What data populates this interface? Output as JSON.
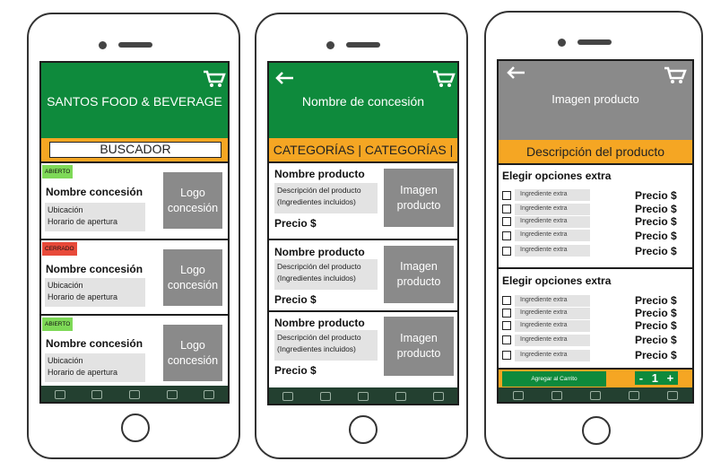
{
  "phone1": {
    "header_title": "SANTOS FOOD & BEVERAGE",
    "search_label": "BUSCADOR",
    "cards": [
      {
        "status": "ABIERTO",
        "name": "Nombre concesión",
        "location": "Ubicación",
        "hours": "Horario de apertura",
        "logo_line1": "Logo",
        "logo_line2": "concesión"
      },
      {
        "status": "CERRADO",
        "name": "Nombre concesión",
        "location": "Ubicación",
        "hours": "Horario de apertura",
        "logo_line1": "Logo",
        "logo_line2": "concesión"
      },
      {
        "status": "ABIERTO",
        "name": "Nombre concesión",
        "location": "Ubicación",
        "hours": "Horario de apertura",
        "logo_line1": "Logo",
        "logo_line2": "concesión"
      }
    ]
  },
  "phone2": {
    "header_title": "Nombre de concesión",
    "categories_label": "CATEGORÍAS | CATEGORÍAS |",
    "products": [
      {
        "name": "Nombre producto",
        "desc_line1": "Descripción del producto",
        "desc_line2": "(Ingredientes incluidos)",
        "price": "Precio $",
        "image_line1": "Imagen",
        "image_line2": "producto"
      },
      {
        "name": "Nombre producto",
        "desc_line1": "Descripción del producto",
        "desc_line2": "(Ingredientes incluidos)",
        "price": "Precio $",
        "image_line1": "Imagen",
        "image_line2": "producto"
      },
      {
        "name": "Nombre producto",
        "desc_line1": "Descripción del producto",
        "desc_line2": "(Ingredientes incluidos)",
        "price": "Precio $",
        "image_line1": "Imagen",
        "image_line2": "producto"
      }
    ]
  },
  "phone3": {
    "header_title": "Imagen producto",
    "description_label": "Descripción del producto",
    "sections": [
      {
        "title": "Elegir opciones extra",
        "options": [
          {
            "label": "Ingrediente extra",
            "price": "Precio $"
          },
          {
            "label": "Ingrediente extra",
            "price": "Precio $"
          },
          {
            "label": "Ingrediente extra",
            "price": "Precio $"
          },
          {
            "label": "Ingrediente extra",
            "price": "Precio $"
          },
          {
            "label": "Ingrediente extra",
            "price": "Precio $"
          }
        ]
      },
      {
        "title": "Elegir opciones extra",
        "options": [
          {
            "label": "Ingrediente extra",
            "price": "Precio $"
          },
          {
            "label": "Ingrediente extra",
            "price": "Precio $"
          },
          {
            "label": "Ingrediente extra",
            "price": "Precio $"
          },
          {
            "label": "Ingrediente extra",
            "price": "Precio $"
          },
          {
            "label": "Ingrediente extra",
            "price": "Precio $"
          }
        ]
      }
    ],
    "add_to_cart_label": "Agregar al Carrito",
    "stepper": {
      "minus": "-",
      "quantity": "1",
      "plus": "+"
    }
  },
  "nav_icons": [
    "menu-icon",
    "people-icon",
    "fire-icon",
    "building-icon",
    "store-icon"
  ],
  "colors": {
    "green": "#0e8a3c",
    "orange": "#f5a623",
    "gray": "#8a8a8a",
    "nav": "#234030",
    "open": "#7ed957",
    "closed": "#e84a3a"
  }
}
